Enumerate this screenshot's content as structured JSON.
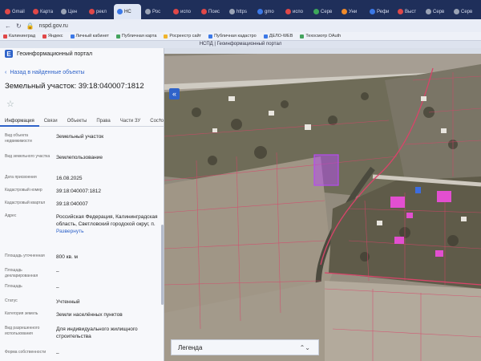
{
  "browser": {
    "tabs": [
      {
        "label": "Gmail",
        "icon": "mail-icon",
        "color": "red"
      },
      {
        "label": "Карта",
        "icon": "yandex-icon",
        "color": "red"
      },
      {
        "label": "Цен",
        "icon": "site-icon",
        "color": "grey"
      },
      {
        "label": "рекл",
        "icon": "site-icon",
        "color": "red"
      },
      {
        "label": "НС",
        "icon": "site-icon",
        "color": "blue",
        "active": true
      },
      {
        "label": "Рос",
        "icon": "site-icon",
        "color": "grey"
      },
      {
        "label": "испо",
        "icon": "site-icon",
        "color": "red"
      },
      {
        "label": "Поис",
        "icon": "site-icon",
        "color": "red"
      },
      {
        "label": "https",
        "icon": "site-icon",
        "color": "grey"
      },
      {
        "label": "gmo",
        "icon": "site-icon",
        "color": "blue"
      },
      {
        "label": "испо",
        "icon": "site-icon",
        "color": "red"
      },
      {
        "label": "Серв",
        "icon": "site-icon",
        "color": "green"
      },
      {
        "label": "Уни",
        "icon": "site-icon",
        "color": "orange"
      },
      {
        "label": "Рефи",
        "icon": "site-icon",
        "color": "blue"
      },
      {
        "label": "Выст",
        "icon": "site-icon",
        "color": "red"
      },
      {
        "label": "Серв",
        "icon": "site-icon",
        "color": "grey"
      },
      {
        "label": "Серв",
        "icon": "site-icon",
        "color": "grey"
      }
    ],
    "url": "nspd.gov.ru",
    "bookmarks": [
      {
        "label": "Калининград",
        "color": "r"
      },
      {
        "label": "Яндекс",
        "color": "r"
      },
      {
        "label": "Личный кабинет",
        "color": "b"
      },
      {
        "label": "Публичная карта",
        "color": "g"
      },
      {
        "label": "Росреестр сайт",
        "color": "y"
      },
      {
        "label": "Публичная кадастро",
        "color": "b"
      },
      {
        "label": "ДЕЛО-WEB",
        "color": "b"
      },
      {
        "label": "Техосмотр ОАuth",
        "color": "g"
      }
    ]
  },
  "portal": {
    "header": "НСПД | Геоинформационный портал",
    "title": "Геоинформационный портал",
    "back_label": "Назад в найденные объекты",
    "object_title": "Земельный участок: 39:18:040007:1812",
    "tabs": [
      "Информация",
      "Связи",
      "Объекты",
      "Права",
      "Части ЗУ",
      "Состо"
    ],
    "properties": [
      {
        "label": "Вид объекта недвижимости",
        "value": "Земельный участок"
      },
      {
        "label": "Вид земельного участка",
        "value": "Землепользование"
      },
      {
        "label": "Дата присвоения",
        "value": "16.08.2025"
      },
      {
        "label": "Кадастровый номер",
        "value": "39:18:040007:1812"
      },
      {
        "label": "Кадастровый квартал",
        "value": "39:18:040007"
      },
      {
        "label": "Адрес",
        "value": "Российская Федерация, Калининградская область, Светловский городской округ, п.",
        "link": "Развернуть"
      },
      {
        "label": "Площадь уточненная",
        "value": "800 кв. м"
      },
      {
        "label": "Площадь декларированная",
        "value": "–"
      },
      {
        "label": "Площадь",
        "value": "–"
      },
      {
        "label": "Статус",
        "value": "Учтенный"
      },
      {
        "label": "Категория земель",
        "value": "Земли населённых пунктов"
      },
      {
        "label": "Вид разрешенного использования",
        "value": "Для индивидуального жилищного строительства"
      },
      {
        "label": "Форма собственности",
        "value": "–"
      }
    ]
  },
  "map": {
    "collapse_icon": "double-chevron-left-icon",
    "legend_label": "Легенда",
    "legend_chevron_icon": "chevron-updown-icon",
    "colors": {
      "boundary": "#d9446a",
      "selected_parcel": "#b64cf0",
      "road": "#c9c4bb"
    }
  }
}
